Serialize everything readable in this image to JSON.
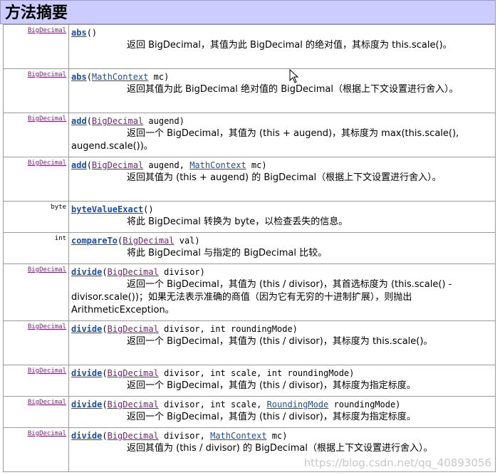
{
  "title": "方法摘要",
  "rows": [
    {
      "type": "BigDecimal",
      "typeLink": true,
      "sig": [
        {
          "t": "m",
          "v": "abs"
        },
        {
          "t": "p",
          "v": "()"
        }
      ],
      "desc": "返回 BigDecimal，其值为此 BigDecimal 的绝对值，其标度为 this.scale()。",
      "h": 62
    },
    {
      "type": "BigDecimal",
      "typeLink": true,
      "sig": [
        {
          "t": "m",
          "v": "abs"
        },
        {
          "t": "p",
          "v": "("
        },
        {
          "t": "l",
          "v": "MathContext"
        },
        {
          "t": "p",
          "v": " mc)"
        }
      ],
      "desc": "返回其值为此 BigDecimal 绝对值的 BigDecimal（根据上下文设置进行舍入）。",
      "h": 62
    },
    {
      "type": "BigDecimal",
      "typeLink": true,
      "sig": [
        {
          "t": "m",
          "v": "add"
        },
        {
          "t": "p",
          "v": "("
        },
        {
          "t": "lp",
          "v": "BigDecimal"
        },
        {
          "t": "p",
          "v": " augend)"
        }
      ],
      "desc": "返回一个 BigDecimal，其值为 (this + augend)，其标度为 max(this.scale(), augend.scale())。",
      "h": 62
    },
    {
      "type": "BigDecimal",
      "typeLink": true,
      "sig": [
        {
          "t": "m",
          "v": "add"
        },
        {
          "t": "p",
          "v": "("
        },
        {
          "t": "lp",
          "v": "BigDecimal"
        },
        {
          "t": "p",
          "v": " augend, "
        },
        {
          "t": "l",
          "v": "MathContext"
        },
        {
          "t": "p",
          "v": " mc)"
        }
      ],
      "desc": "返回其值为 (this + augend) 的 BigDecimal（根据上下文设置进行舍入）。",
      "h": 62
    },
    {
      "type": "byte",
      "typeLink": false,
      "sig": [
        {
          "t": "m",
          "v": "byteValueExact"
        },
        {
          "t": "p",
          "v": "()"
        }
      ],
      "desc": "将此 BigDecimal 转换为 byte，以检查丢失的信息。",
      "h": 44
    },
    {
      "type": "int",
      "typeLink": false,
      "sig": [
        {
          "t": "m",
          "v": "compareTo"
        },
        {
          "t": "p",
          "v": "("
        },
        {
          "t": "lp",
          "v": "BigDecimal"
        },
        {
          "t": "p",
          "v": " val)"
        }
      ],
      "desc": "将此 BigDecimal 与指定的 BigDecimal 比较。",
      "h": 44
    },
    {
      "type": "BigDecimal",
      "typeLink": true,
      "sig": [
        {
          "t": "m",
          "v": "divide"
        },
        {
          "t": "p",
          "v": "("
        },
        {
          "t": "lp",
          "v": "BigDecimal"
        },
        {
          "t": "p",
          "v": " divisor)"
        }
      ],
      "desc": "返回一个 BigDecimal，其值为 (this / divisor)，其首选标度为 (this.scale() - divisor.scale())；如果无法表示准确的商值（因为它有无穷的十进制扩展），则抛出 ArithmeticException。",
      "h": 80
    },
    {
      "type": "BigDecimal",
      "typeLink": true,
      "sig": [
        {
          "t": "m",
          "v": "divide"
        },
        {
          "t": "p",
          "v": "("
        },
        {
          "t": "lp",
          "v": "BigDecimal"
        },
        {
          "t": "p",
          "v": " divisor, int roundingMode)"
        }
      ],
      "desc": "返回一个 BigDecimal，其值为 (this / divisor)，其标度为 this.scale()。",
      "h": 62
    },
    {
      "type": "BigDecimal",
      "typeLink": true,
      "sig": [
        {
          "t": "m",
          "v": "divide"
        },
        {
          "t": "p",
          "v": "("
        },
        {
          "t": "lp",
          "v": "BigDecimal"
        },
        {
          "t": "p",
          "v": " divisor, int scale, int roundingMode)"
        }
      ],
      "desc": "返回一个 BigDecimal，其值为 (this / divisor)，其标度为指定标度。",
      "h": 44
    },
    {
      "type": "BigDecimal",
      "typeLink": true,
      "sig": [
        {
          "t": "m",
          "v": "divide"
        },
        {
          "t": "p",
          "v": "("
        },
        {
          "t": "lp",
          "v": "BigDecimal"
        },
        {
          "t": "p",
          "v": " divisor, int scale, "
        },
        {
          "t": "l",
          "v": "RoundingMode"
        },
        {
          "t": "p",
          "v": " roundingMode)"
        }
      ],
      "desc": "返回一个 BigDecimal，其值为 (this / divisor)，其标度为指定标度。",
      "h": 44
    },
    {
      "type": "BigDecimal",
      "typeLink": true,
      "sig": [
        {
          "t": "m",
          "v": "divide"
        },
        {
          "t": "p",
          "v": "("
        },
        {
          "t": "lp",
          "v": "BigDecimal"
        },
        {
          "t": "p",
          "v": " divisor, "
        },
        {
          "t": "l",
          "v": "MathContext"
        },
        {
          "t": "p",
          "v": " mc)"
        }
      ],
      "desc": "返回其值为 (this / divisor) 的 BigDecimal（根据上下文设置进行舍入）。",
      "h": 62
    }
  ],
  "watermark": "https://blog.csdn.net/qq_40893056"
}
